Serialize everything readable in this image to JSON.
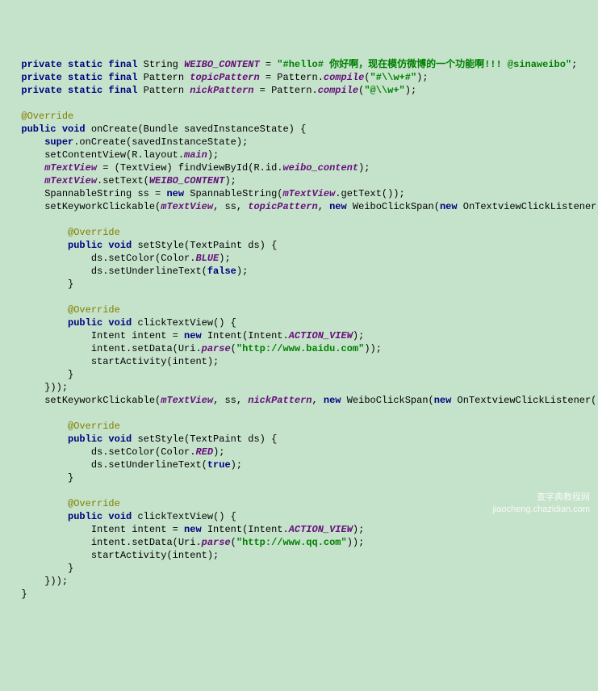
{
  "lines": {
    "l1": {
      "kw1": "private static final",
      "type": "String",
      "name": "WEIBO_CONTENT",
      "eq": " = ",
      "str": "\"#hello# 你好啊，现在模仿微博的一个功能啊!!! @sinaweibo\"",
      "semi": ";"
    },
    "l2": {
      "kw1": "private static final",
      "type": "Pattern",
      "name": "topicPattern",
      "eq": " = Pattern.",
      "method": "compile",
      "str": "\"#\\\\w+#\"",
      "close": ");"
    },
    "l3": {
      "kw1": "private static final",
      "type": "Pattern",
      "name": "nickPattern",
      "eq": " = Pattern.",
      "method": "compile",
      "str": "\"@\\\\w+\"",
      "close": ");"
    },
    "ann1": "@Override",
    "l4": {
      "kw": "public void",
      "method": "onCreate",
      "params": "(Bundle savedInstanceState) {"
    },
    "l5": {
      "kw": "super",
      "call": ".onCreate(savedInstanceState);"
    },
    "l6": {
      "call1": "setContentView(R.layout.",
      "field": "main",
      "close": ");"
    },
    "l7": {
      "field": "mTextView",
      "mid": " = (TextView) findViewById(R.id.",
      "field2": "weibo_content",
      "close": ");"
    },
    "l8": {
      "field": "mTextView",
      "call": ".setText(",
      "field2": "WEIBO_CONTENT",
      "close": ");"
    },
    "l9": {
      "t1": "SpannableString ss = ",
      "kw": "new",
      "t2": " SpannableString(",
      "field": "mTextView",
      "t3": ".getText());"
    },
    "l10": {
      "call": "setKeyworkClickable(",
      "f1": "mTextView",
      "c": ", ss, ",
      "f2": "topicPattern",
      "c2": ", ",
      "kw": "new",
      "t": " WeiboClickSpan(",
      "kw2": "new",
      "t2": " OnTextviewClickListener() {"
    },
    "ann2": "@Override",
    "l11": {
      "kw": "public void",
      "method": "setStyle",
      "params": "(TextPaint ds) {"
    },
    "l12": {
      "t": "ds.setColor(Color.",
      "field": "BLUE",
      "close": ");"
    },
    "l13": {
      "t": "ds.setUnderlineText(",
      "kw": "false",
      "close": ");"
    },
    "close1": "}",
    "ann3": "@Override",
    "l14": {
      "kw": "public void",
      "method": "clickTextView",
      "params": "() {"
    },
    "l15": {
      "t": "Intent intent = ",
      "kw": "new",
      "t2": " Intent(Intent.",
      "field": "ACTION_VIEW",
      "close": ");"
    },
    "l16": {
      "t": "intent.setData(Uri.",
      "method": "parse",
      "open": "(",
      "str": "\"http://www.baidu.com\"",
      "close": "));"
    },
    "l17": {
      "t": "startActivity(intent);"
    },
    "close2": "}",
    "close3": "}));",
    "l18": {
      "call": "setKeyworkClickable(",
      "f1": "mTextView",
      "c": ", ss, ",
      "f2": "nickPattern",
      "c2": ", ",
      "kw": "new",
      "t": " WeiboClickSpan(",
      "kw2": "new",
      "t2": " OnTextviewClickListener() {"
    },
    "ann4": "@Override",
    "l19": {
      "kw": "public void",
      "method": "setStyle",
      "params": "(TextPaint ds) {"
    },
    "l20": {
      "t": "ds.setColor(Color.",
      "field": "RED",
      "close": ");"
    },
    "l21": {
      "t": "ds.setUnderlineText(",
      "kw": "true",
      "close": ");"
    },
    "close4": "}",
    "ann5": "@Override",
    "l22": {
      "kw": "public void",
      "method": "clickTextView",
      "params": "() {"
    },
    "l23": {
      "t": "Intent intent = ",
      "kw": "new",
      "t2": " Intent(Intent.",
      "field": "ACTION_VIEW",
      "close": ");"
    },
    "l24": {
      "t": "intent.setData(Uri.",
      "method": "parse",
      "open": "(",
      "str": "\"http://www.qq.com\"",
      "close": "));"
    },
    "l25": {
      "t": "startActivity(intent);"
    },
    "close5": "}",
    "close6": "}));",
    "close7": "}"
  },
  "watermark": {
    "line1": "查字典教程网",
    "line2": "jiaocheng.chazidian.com"
  }
}
